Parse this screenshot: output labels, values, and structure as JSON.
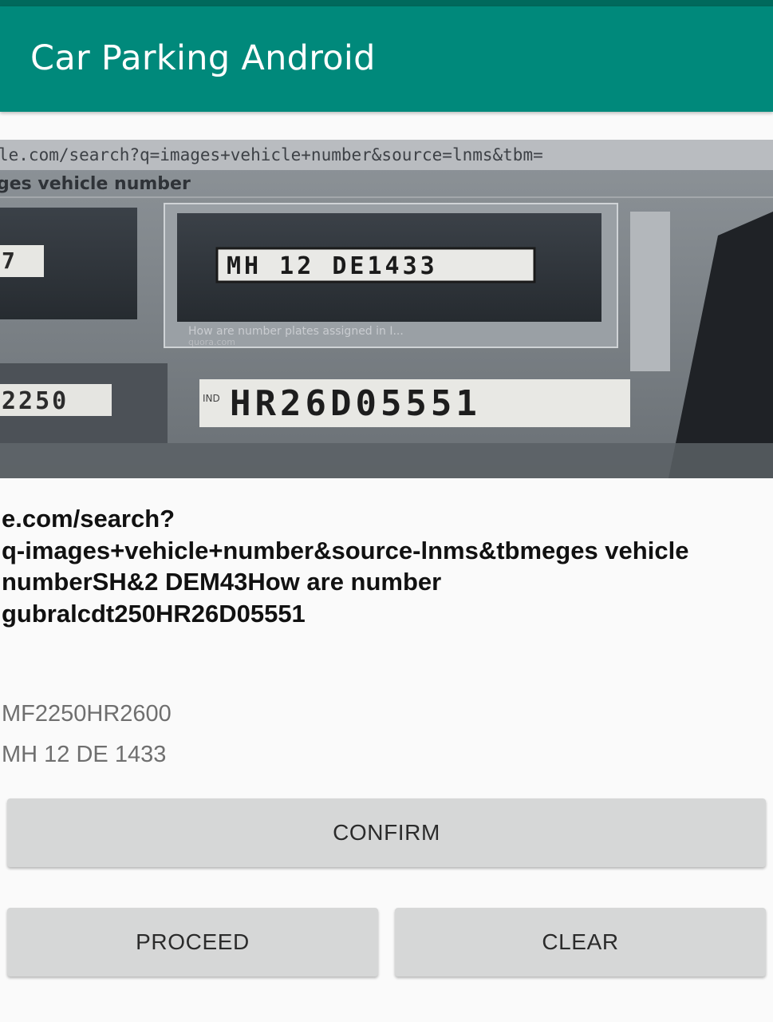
{
  "app_bar": {
    "title": "Car Parking Android"
  },
  "photo": {
    "url_bar_text": "le.com/search?q=images+vehicle+number&source=lnms&tbm=",
    "search_query_text": "ges vehicle number",
    "plate_left_top": "7",
    "plate_main": "MH 12 DE1433",
    "caption_line": "How are number plates assigned in I...",
    "caption_source": "quora.com",
    "plate_left_bottom": "2250",
    "plate_bottom_prefix": "IND",
    "plate_bottom": "HR26D05551"
  },
  "ocr_result": "e.com/search?\nq-images+vehicle+number&source-lnms&tbmeges vehicle\nnumberSH&2 DEM43How are number\ngubralcdt250HR26D05551",
  "plates": {
    "line1": "MF2250HR2600",
    "line2": "MH 12 DE 1433"
  },
  "buttons": {
    "confirm": "CONFIRM",
    "proceed": "PROCEED",
    "clear": "CLEAR"
  },
  "colors": {
    "app_bar": "#00897b",
    "status_bar": "#00695c",
    "button_bg": "#d6d7d7"
  }
}
